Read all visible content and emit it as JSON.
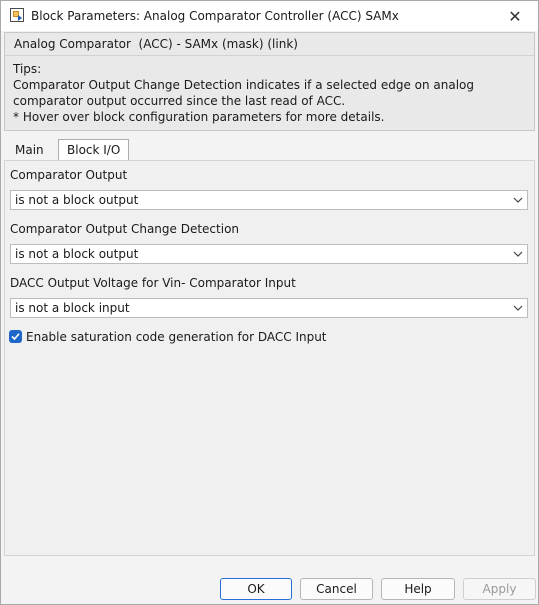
{
  "window": {
    "title": "Block Parameters: Analog Comparator Controller (ACC) SAMx",
    "close_symbol": "✕",
    "icons": {
      "app": "simulink-block-icon",
      "close": "close-icon"
    }
  },
  "header": {
    "title": "Analog Comparator  (ACC) - SAMx (mask) (link)",
    "tips_label": "Tips:",
    "tips_line1": "Comparator Output Change Detection indicates if a selected edge on analog comparator output occurred since the last read of ACC.",
    "tips_line2": "* Hover over block configuration parameters for more details."
  },
  "tabs": [
    {
      "label": "Main",
      "selected": false
    },
    {
      "label": "Block I/O",
      "selected": true
    }
  ],
  "fields": [
    {
      "label": "Comparator Output",
      "value": "is not a block output"
    },
    {
      "label": "Comparator Output Change Detection",
      "value": "is not a block output"
    },
    {
      "label": "DACC Output Voltage for Vin- Comparator Input",
      "value": "is not a block input"
    }
  ],
  "checkbox": {
    "label": "Enable saturation code generation for DACC Input",
    "checked": true
  },
  "buttons": {
    "ok": "OK",
    "cancel": "Cancel",
    "help": "Help",
    "apply": "Apply"
  },
  "colors": {
    "accent": "#1f66c9",
    "disabled_text": "#9a9a9a"
  }
}
